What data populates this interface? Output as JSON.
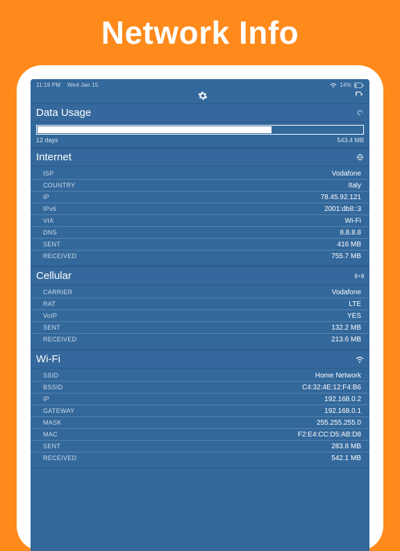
{
  "hero_title": "Network Info",
  "statusbar": {
    "time": "11:19 PM",
    "date": "Wed Jan 15",
    "battery": "14%"
  },
  "data_usage": {
    "title": "Data Usage",
    "period": "12 days",
    "total": "543.4 MB",
    "progress_percent": 72
  },
  "internet": {
    "title": "Internet",
    "rows": [
      {
        "k": "ISP",
        "v": "Vodafone"
      },
      {
        "k": "COUNTRY",
        "v": "Italy"
      },
      {
        "k": "IP",
        "v": "78.45.92.121"
      },
      {
        "k": "IPv6",
        "v": "2001:db8::3"
      },
      {
        "k": "VIA",
        "v": "Wi-Fi"
      },
      {
        "k": "DNS",
        "v": "8.8.8.8"
      },
      {
        "k": "SENT",
        "v": "416 MB"
      },
      {
        "k": "RECEIVED",
        "v": "755.7 MB"
      }
    ]
  },
  "cellular": {
    "title": "Cellular",
    "rows": [
      {
        "k": "CARRIER",
        "v": "Vodafone"
      },
      {
        "k": "RAT",
        "v": "LTE"
      },
      {
        "k": "VoIP",
        "v": "YES"
      },
      {
        "k": "SENT",
        "v": "132.2 MB"
      },
      {
        "k": "RECEIVED",
        "v": "213.6 MB"
      }
    ]
  },
  "wifi": {
    "title": "Wi-Fi",
    "rows": [
      {
        "k": "SSID",
        "v": "Home Network"
      },
      {
        "k": "BSSID",
        "v": "C4:32:4E:12:F4:B6"
      },
      {
        "k": "IP",
        "v": "192.168.0.2"
      },
      {
        "k": "GATEWAY",
        "v": "192.168.0.1"
      },
      {
        "k": "MASK",
        "v": "255.255.255.0"
      },
      {
        "k": "MAC",
        "v": "F2:E4:CC:D5:AB:D8"
      },
      {
        "k": "SENT",
        "v": "283.8 MB"
      },
      {
        "k": "RECEIVED",
        "v": "542.1 MB"
      }
    ]
  }
}
